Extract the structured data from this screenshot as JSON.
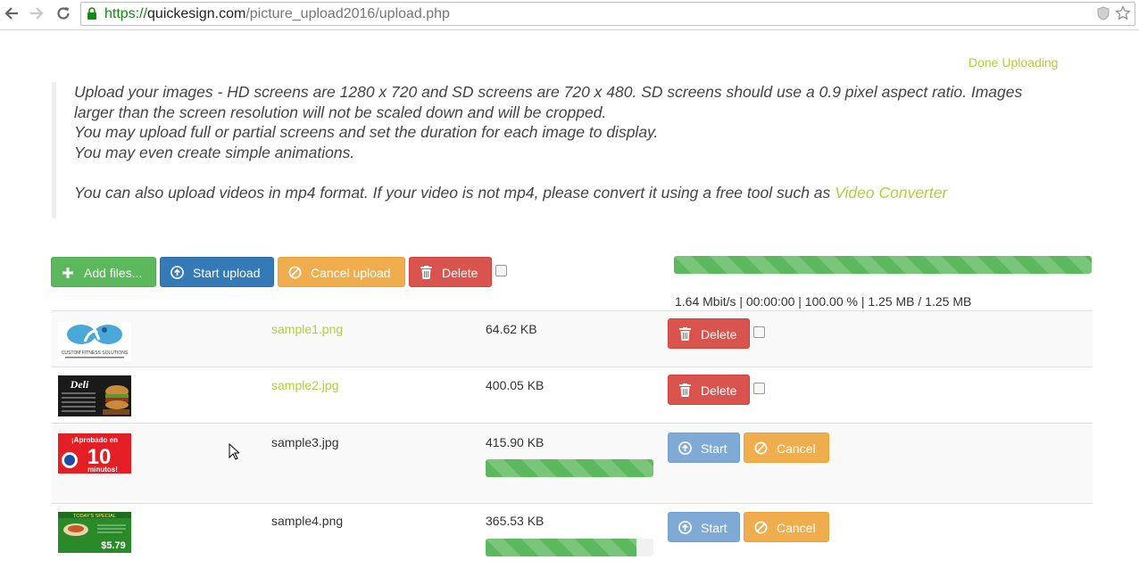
{
  "browser": {
    "url_scheme": "https://",
    "url_host": "quickesign.com",
    "url_path": "/picture_upload2016/upload.php"
  },
  "page": {
    "done_link": "Done Uploading",
    "info_lines": [
      "Upload your images - HD screens are 1280 x 720 and SD screens are 720 x 480. SD screens should use a 0.9 pixel aspect ratio. Images",
      "larger than the screen resolution will not be scaled down and will be cropped.",
      "You may upload full or partial screens and set the duration for each image to display.",
      "You may even create simple animations."
    ],
    "video_text": "You can also upload videos in mp4 format. If your video is not mp4, please convert it using a free tool such as ",
    "video_link": "Video Converter"
  },
  "toolbar": {
    "add_files": "Add files...",
    "start_upload": "Start upload",
    "cancel_upload": "Cancel upload",
    "delete": "Delete"
  },
  "global_progress": {
    "percent": 100,
    "stats": "1.64 Mbit/s | 00:00:00 | 100.00 % | 1.25 MB / 1.25 MB"
  },
  "files": [
    {
      "name": "sample1.png",
      "size": "64.62 KB",
      "status": "uploaded",
      "action": "Delete"
    },
    {
      "name": "sample2.jpg",
      "size": "400.05 KB",
      "status": "uploaded",
      "action": "Delete"
    },
    {
      "name": "sample3.jpg",
      "size": "415.90 KB",
      "status": "pending",
      "progress_percent": 100,
      "start": "Start",
      "cancel": "Cancel"
    },
    {
      "name": "sample4.png",
      "size": "365.53 KB",
      "status": "pending",
      "progress_percent": 90,
      "start": "Start",
      "cancel": "Cancel"
    }
  ],
  "thumbnails": {
    "sample1": {
      "caption": "CUSTOM FITNESS SOLUTIONS"
    },
    "sample2": {
      "title": "Deli"
    },
    "sample3": {
      "top": "¡Aprobado en",
      "big": "10",
      "bottom": "minutos!"
    },
    "sample4": {
      "header": "TODAY'S SPECIAL",
      "price": "$5.79"
    }
  },
  "colors": {
    "link": "#b4cc3e",
    "success": "#5cb85c",
    "primary": "#337ab7",
    "warning": "#f0ad4e",
    "danger": "#d9534f",
    "disabled_primary": "#80aad6"
  },
  "icons": {
    "back": "arrow-left-icon",
    "forward": "arrow-right-icon",
    "reload": "reload-icon",
    "lock": "lock-icon",
    "shield": "shield-icon",
    "star": "star-icon",
    "plus": "plus-icon",
    "upload": "upload-circle-icon",
    "ban": "ban-icon",
    "trash": "trash-icon"
  }
}
